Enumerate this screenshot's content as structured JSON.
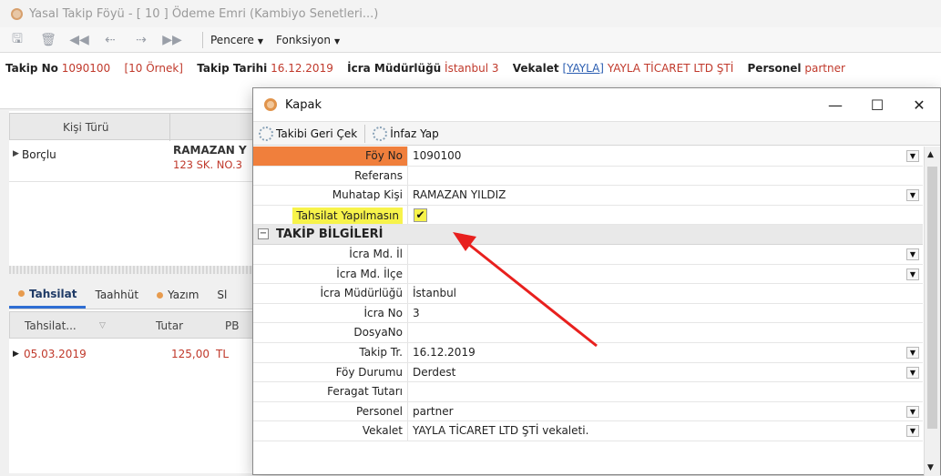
{
  "main_window": {
    "title": "Yasal Takip Föyü - [ 10 ] Ödeme Emri (Kambiyo Senetleri...)",
    "toolbar": {
      "icons": [
        "save-icon",
        "delete-icon",
        "first-record-icon",
        "previous-record-icon",
        "next-record-icon",
        "last-record-icon"
      ],
      "menus": [
        "Pencere",
        "Fonksiyon"
      ]
    },
    "info": {
      "takip_no_label": "Takip No",
      "takip_no": "1090100",
      "ornek": "[10 Örnek]",
      "takip_tarihi_label": "Takip Tarihi",
      "takip_tarihi": "16.12.2019",
      "icra_label": "İcra Müdürlüğü",
      "icra": "İstanbul 3",
      "vekalet_label": "Vekalet",
      "vekalet_link": "[YAYLA]",
      "vekalet": "YAYLA TİCARET LTD ŞTİ",
      "personel_label": "Personel",
      "personel": "partner"
    },
    "party_grid": {
      "header": "Kişi Türü",
      "row": {
        "type": "Borçlu",
        "name": "RAMAZAN Y",
        "address": "123 SK. NO.3"
      }
    },
    "tabs": [
      "Tahsilat",
      "Taahhüt",
      "Yazım",
      "Sl"
    ],
    "payment_grid": {
      "headers": [
        "Tahsilat...",
        "Tutar",
        "PB"
      ],
      "row": {
        "date": "05.03.2019",
        "amount": "125,00",
        "currency": "TL"
      }
    }
  },
  "dialog": {
    "title": "Kapak",
    "toolbar": {
      "takibi_geri_cek": "Takibi Geri Çek",
      "infaz_yap": "İnfaz Yap"
    },
    "rows": [
      {
        "label": "Föy No",
        "value": "1090100",
        "combo": true,
        "selected": true
      },
      {
        "label": "Referans",
        "value": ""
      },
      {
        "label": "Muhatap Kişi",
        "value": "RAMAZAN YILDIZ",
        "combo": true
      },
      {
        "label": "Tahsilat Yapılmasın",
        "value": "✔",
        "checkbox": true,
        "checked": true,
        "highlight": true
      }
    ],
    "category": {
      "toggle": "−",
      "label": "TAKİP BİLGİLERİ"
    },
    "takip_rows": [
      {
        "label": "İcra Md. İl",
        "value": "",
        "combo": true
      },
      {
        "label": "İcra Md. İlçe",
        "value": "",
        "combo": true
      },
      {
        "label": "İcra Müdürlüğü",
        "value": "İstanbul"
      },
      {
        "label": "İcra No",
        "value": "3"
      },
      {
        "label": "DosyaNo",
        "value": ""
      },
      {
        "label": "Takip Tr.",
        "value": "16.12.2019",
        "combo": true
      },
      {
        "label": "Föy Durumu",
        "value": "Derdest",
        "combo": true
      },
      {
        "label": "Feragat Tutarı",
        "value": ""
      },
      {
        "label": "Personel",
        "value": "partner",
        "combo": true
      },
      {
        "label": "Vekalet",
        "value": "YAYLA TİCARET LTD ŞTİ vekaleti.",
        "combo": true
      }
    ],
    "colors": {
      "selected_label": "#f07f3c",
      "highlight": "#f7f34a",
      "arrow": "#e8201e"
    }
  }
}
